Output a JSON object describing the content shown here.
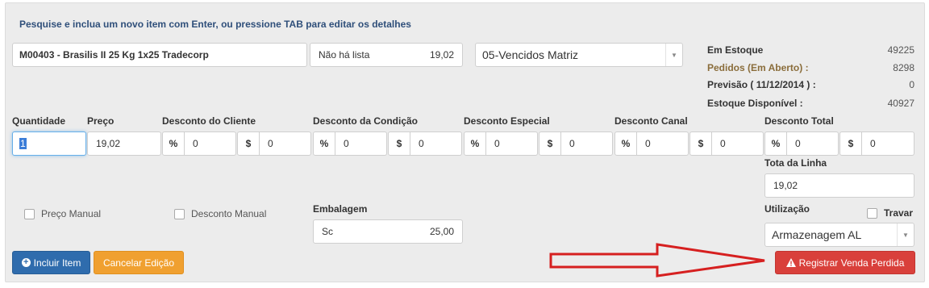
{
  "hint": "Pesquise e inclua um novo item com Enter, ou pressione TAB para editar os detalhes",
  "product": {
    "value": "M00403 - Brasilis II 25 Kg 1x25 Tradecorp"
  },
  "list": {
    "label": "Não há lista",
    "price": "19,02"
  },
  "warehouse_select": {
    "value": "05-Vencidos Matriz"
  },
  "stock": {
    "em_estoque": {
      "label": "Em Estoque",
      "value": "49225"
    },
    "pedidos": {
      "label": "Pedidos (Em Aberto) :",
      "value": "8298"
    },
    "previsao": {
      "label": "Previsão ( 11/12/2014 ) :",
      "value": "0"
    },
    "disponivel": {
      "label": "Estoque Disponível :",
      "value": "40927"
    }
  },
  "labels": {
    "quantidade": "Quantidade",
    "preco": "Preço",
    "desc_cliente": "Desconto do Cliente",
    "desc_condicao": "Desconto da Condição",
    "desc_especial": "Desconto Especial",
    "desc_canal": "Desconto Canal",
    "desc_total": "Desconto Total",
    "total_linha": "Tota da Linha",
    "embalagem": "Embalagem",
    "utilizacao": "Utilização",
    "travar": "Travar"
  },
  "symbols": {
    "percent": "%",
    "dollar": "$"
  },
  "values": {
    "quantidade": "1",
    "preco": "19,02",
    "desc_cliente_pct": "0",
    "desc_cliente_val": "0",
    "desc_condicao_pct": "0",
    "desc_condicao_val": "0",
    "desc_especial_pct": "0",
    "desc_especial_val": "0",
    "desc_canal_pct": "0",
    "desc_canal_val": "0",
    "desc_total_pct": "0",
    "desc_total_val": "0",
    "total_linha": "19,02",
    "embalagem_unit": "Sc",
    "embalagem_qty": "25,00",
    "utilizacao": "Armazenagem AL"
  },
  "checkboxes": {
    "preco_manual": "Preço Manual",
    "desconto_manual": "Desconto Manual"
  },
  "buttons": {
    "incluir": "Incluir Item",
    "cancelar": "Cancelar Edição",
    "registrar": "Registrar Venda Perdida"
  },
  "colors": {
    "primary": "#2f6cad",
    "warning": "#f0a030",
    "danger": "#d9403b",
    "arrow": "#d62020",
    "link_label": "#8a6d3b"
  }
}
